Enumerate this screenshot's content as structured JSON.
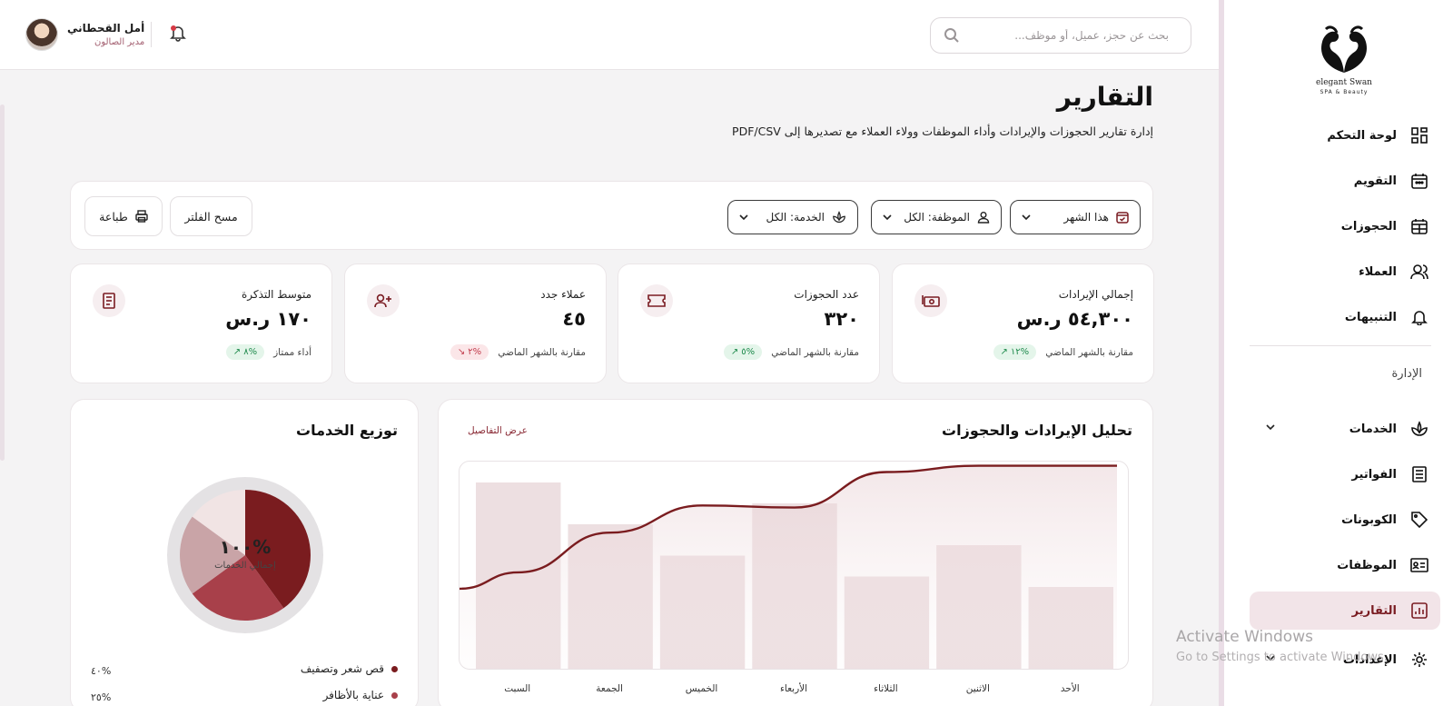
{
  "sidebar": {
    "brand": "elegant Swan",
    "brand_sub": "SPA & Beauty",
    "items": [
      {
        "label": "لوحة التحكم",
        "icon": "dashboard-icon"
      },
      {
        "label": "التقويم",
        "icon": "calendar-icon"
      },
      {
        "label": "الحجوزات",
        "icon": "calendar-grid-icon"
      },
      {
        "label": "العملاء",
        "icon": "users-icon"
      },
      {
        "label": "التنبيهات",
        "icon": "bell-icon"
      }
    ],
    "section_label": "الإدارة",
    "admin_items": [
      {
        "label": "الخدمات",
        "icon": "lotus-icon"
      },
      {
        "label": "الفواتير",
        "icon": "invoice-icon"
      },
      {
        "label": "الكوبونات",
        "icon": "tag-icon"
      },
      {
        "label": "الموظفات",
        "icon": "id-card-icon"
      },
      {
        "label": "التقارير",
        "icon": "report-icon",
        "active": true
      },
      {
        "label": "الإعدادات",
        "icon": "gear-icon"
      }
    ]
  },
  "topbar": {
    "search_placeholder": "بحث عن حجز، عميل، أو موظف...",
    "user_name": "أمل القحطاني",
    "user_role": "مدير الصالون"
  },
  "page": {
    "title": "التقارير",
    "subtitle": "إدارة تقارير الحجوزات والإيرادات وأداء الموظفات وولاء العملاء مع تصديرها إلى PDF/CSV"
  },
  "filters": {
    "period": "هذا الشهر",
    "employee": "الموظفة: الكل",
    "service": "الخدمة: الكل",
    "clear_label": "مسح الفلتر",
    "print_label": "طباعة"
  },
  "kpis": [
    {
      "title": "إجمالي الإيرادات",
      "value": "٥٤,٣٠٠ ر.س",
      "badge": "١٢%",
      "trend": "up",
      "note": "مقارنة بالشهر الماضي"
    },
    {
      "title": "عدد الحجوزات",
      "value": "٣٢٠",
      "badge": "٥%",
      "trend": "up",
      "note": "مقارنة بالشهر الماضي"
    },
    {
      "title": "عملاء جدد",
      "value": "٤٥",
      "badge": "٢%",
      "trend": "down",
      "note": "مقارنة بالشهر الماضي"
    },
    {
      "title": "متوسط التذكرة",
      "value": "١٧٠ ر.س",
      "badge": "٨%",
      "trend": "up",
      "note": "أداء ممتاز"
    }
  ],
  "revenue_card": {
    "title": "تحليل الإيرادات والحجوزات",
    "link": "عرض التفاصيل"
  },
  "services_card": {
    "title": "توزيع الخدمات",
    "center_value": "١٠٠%",
    "center_label": "إجمالي الخدمات",
    "legend": [
      {
        "label": "قص شعر وتصفيف",
        "pct": "٤٠%",
        "color": "#7a1c1f"
      },
      {
        "label": "عناية بالأظافر",
        "pct": "٢٥%",
        "color": "#a8404a"
      }
    ]
  },
  "chart_data": [
    {
      "type": "bar",
      "categories": [
        "الأحد",
        "الاثنين",
        "الثلاثاء",
        "الأربعاء",
        "الخميس",
        "الجمعة",
        "السبت"
      ],
      "series": [
        {
          "type": "bar",
          "values": [
            40,
            60,
            45,
            80,
            55,
            70,
            90
          ]
        },
        {
          "type": "line",
          "values": [
            98,
            98,
            95,
            78,
            79,
            66,
            47
          ]
        }
      ],
      "ylim": [
        0,
        100
      ],
      "grid": false,
      "colors": {
        "bar": "#eddfe1",
        "line": "#7a1c1f"
      }
    },
    {
      "type": "pie",
      "categories": [
        "قص شعر وتصفيف",
        "عناية بالأظافر",
        "",
        ""
      ],
      "values": [
        40,
        25,
        20,
        15
      ],
      "colors": [
        "#7a1c1f",
        "#a8404a",
        "#c9a4a7",
        "#f1e4e4"
      ]
    }
  ],
  "watermark": {
    "line1": "Activate Windows",
    "line2": "Go to Settings to activate Windows."
  }
}
